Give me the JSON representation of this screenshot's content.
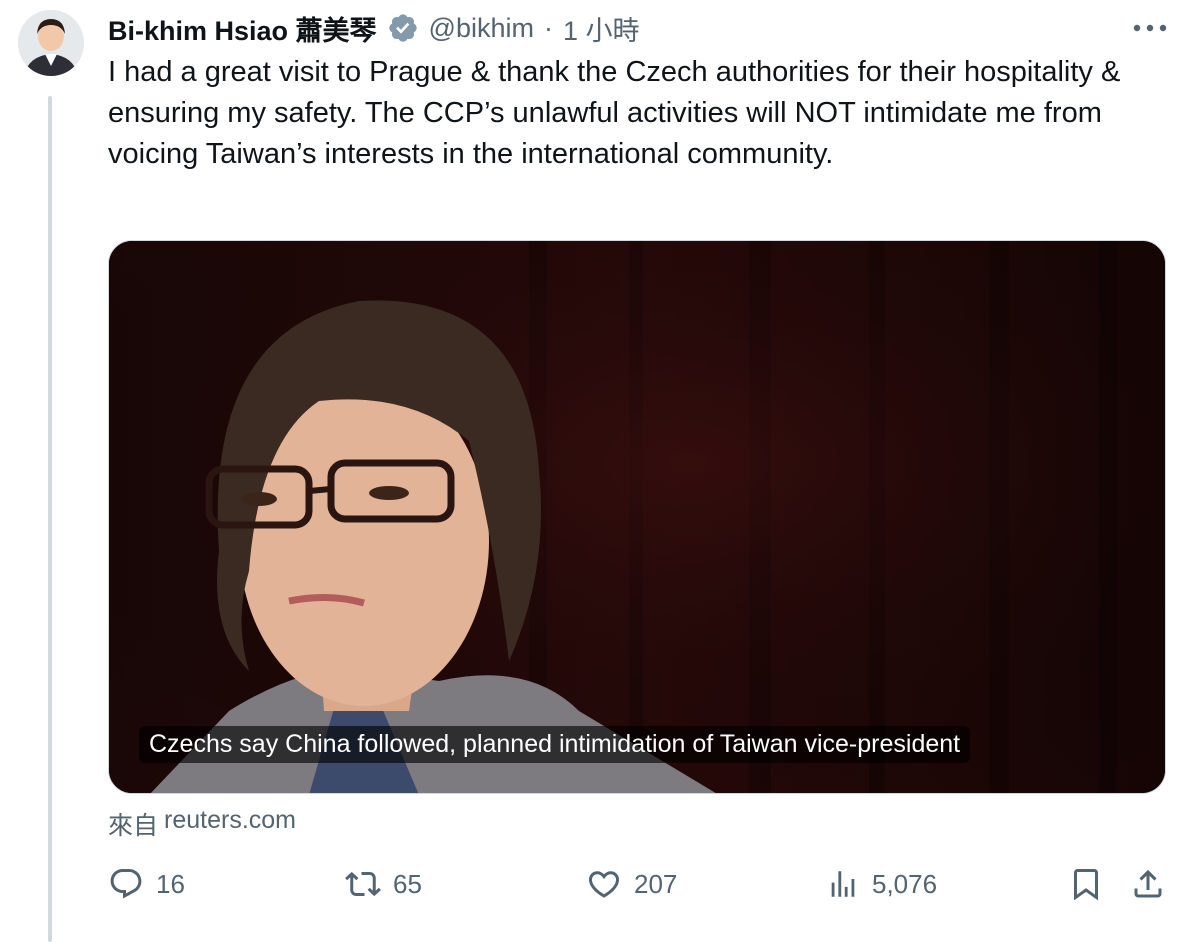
{
  "author": {
    "display_name": "Bi-khim Hsiao 蕭美琴",
    "handle": "@bikhim",
    "separator": "·",
    "time": "1 小時",
    "verified": true,
    "verified_color": "#829aab"
  },
  "tweet": {
    "text": "I had a great visit to Prague & thank the Czech authorities for their hospitality & ensuring my safety.  The CCP’s unlawful activities will NOT intimidate me from voicing Taiwan’s interests in the international community."
  },
  "card": {
    "caption": "Czechs say China followed, planned intimidation of Taiwan vice-president",
    "source_prefix": "來自",
    "source_domain": "reuters.com"
  },
  "actions": {
    "replies": "16",
    "reposts": "65",
    "likes": "207",
    "views": "5,076"
  },
  "icons": {
    "more": "more-horizontal-icon",
    "reply": "reply-icon",
    "repost": "repost-icon",
    "like": "heart-icon",
    "views": "views-icon",
    "bookmark": "bookmark-icon",
    "share": "share-icon",
    "verified": "verified-badge-icon"
  },
  "colors": {
    "text_primary": "#0f1419",
    "text_secondary": "#536471",
    "border": "#cfd9de"
  }
}
